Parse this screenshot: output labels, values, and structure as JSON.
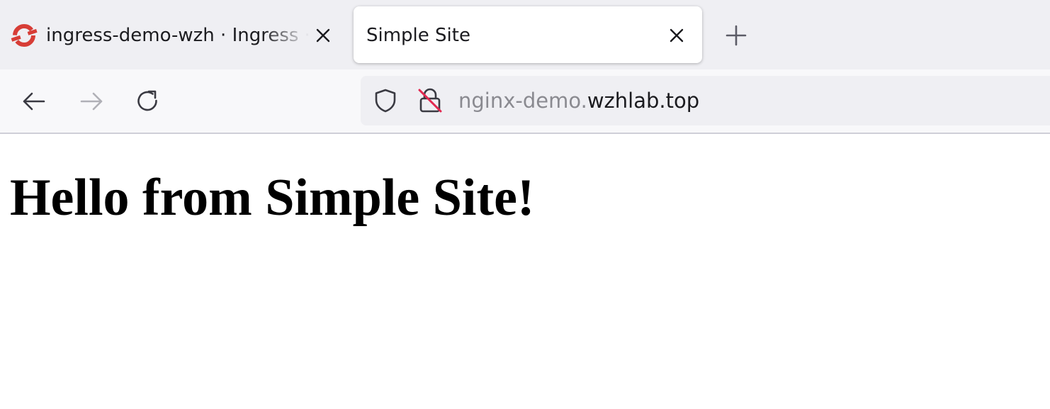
{
  "tabs": [
    {
      "title": "ingress-demo-wzh · Ingress · YAML",
      "active": false,
      "favicon": "openshift-logo-icon"
    },
    {
      "title": "Simple Site",
      "active": true
    }
  ],
  "toolbar": {
    "back_icon": "arrow-left-icon",
    "forward_icon": "arrow-right-icon",
    "reload_icon": "reload-icon",
    "new_tab_icon": "plus-icon"
  },
  "urlbar": {
    "subdomain": "nginx-demo.",
    "domain": "wzhlab.top",
    "tracking_icon": "shield-icon",
    "security_icon": "insecure-lock-icon"
  },
  "page": {
    "heading": "Hello from Simple Site!"
  },
  "colors": {
    "tabstrip_bg": "#efeff3",
    "navbar_bg": "#f8f8fa",
    "favicon_red": "#d73d36",
    "insecure_strike": "#e22850",
    "icon_gray": "#5b5b66"
  }
}
